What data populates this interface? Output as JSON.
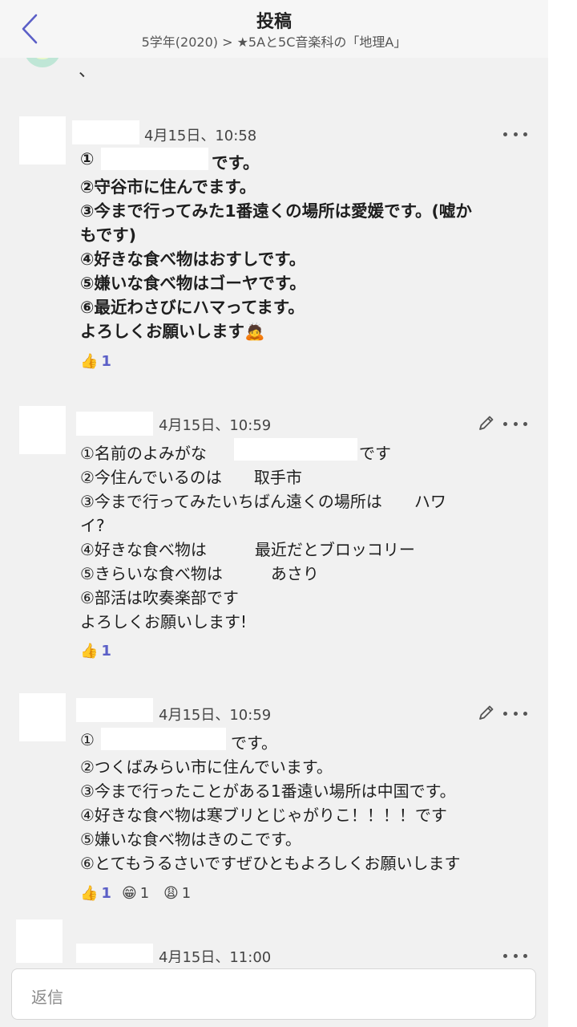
{
  "header": {
    "title": "投稿",
    "breadcrumb": "5学年(2020) > ★5Aと5C音楽科の「地理A」"
  },
  "top_fragment": "、",
  "posts": [
    {
      "timestamp": "4月15日、10:58",
      "lines": [
        "①",
        "です。",
        "②守谷市に住んでます。",
        "③今まで行ってみた1番遠くの場所は愛媛です。(嘘か",
        "もです)",
        "④好きな食べ物はおすしです。",
        "⑤嫌いな食べ物はゴーヤです。",
        "⑥最近わさびにハマってます。",
        "よろしくお願いします🙇"
      ],
      "reactions": [
        {
          "icon": "👍",
          "count": "1"
        }
      ]
    },
    {
      "timestamp": "4月15日、10:59",
      "lines": [
        "①名前のよみがな",
        "です",
        "②今住んでいるのは　　取手市",
        "③今まで行ってみたいちばん遠くの場所は　　ハワ",
        "イ?",
        "④好きな食べ物は　　　最近だとブロッコリー",
        "⑤きらいな食べ物は　　　あさり",
        "⑥部活は吹奏楽部です",
        "よろしくお願いします!"
      ],
      "reactions": [
        {
          "icon": "👍",
          "count": "1"
        }
      ]
    },
    {
      "timestamp": "4月15日、10:59",
      "lines": [
        "①",
        "です。",
        "②つくばみらい市に住んでいます。",
        "③今まで行ったことがある1番遠い場所は中国です。",
        "④好きな食べ物は寒ブリとじゃがりこ！！！！です",
        "⑤嫌いな食べ物はきのこです。",
        "⑥とてもうるさいですぜひともよろしくお願いします"
      ],
      "reactions": [
        {
          "icon": "👍",
          "count": "1"
        },
        {
          "icon": "😁",
          "count": "1"
        },
        {
          "icon": "😩",
          "count": "1"
        }
      ]
    },
    {
      "timestamp": "4月15日、11:00"
    }
  ],
  "reply": {
    "placeholder": "返信"
  }
}
